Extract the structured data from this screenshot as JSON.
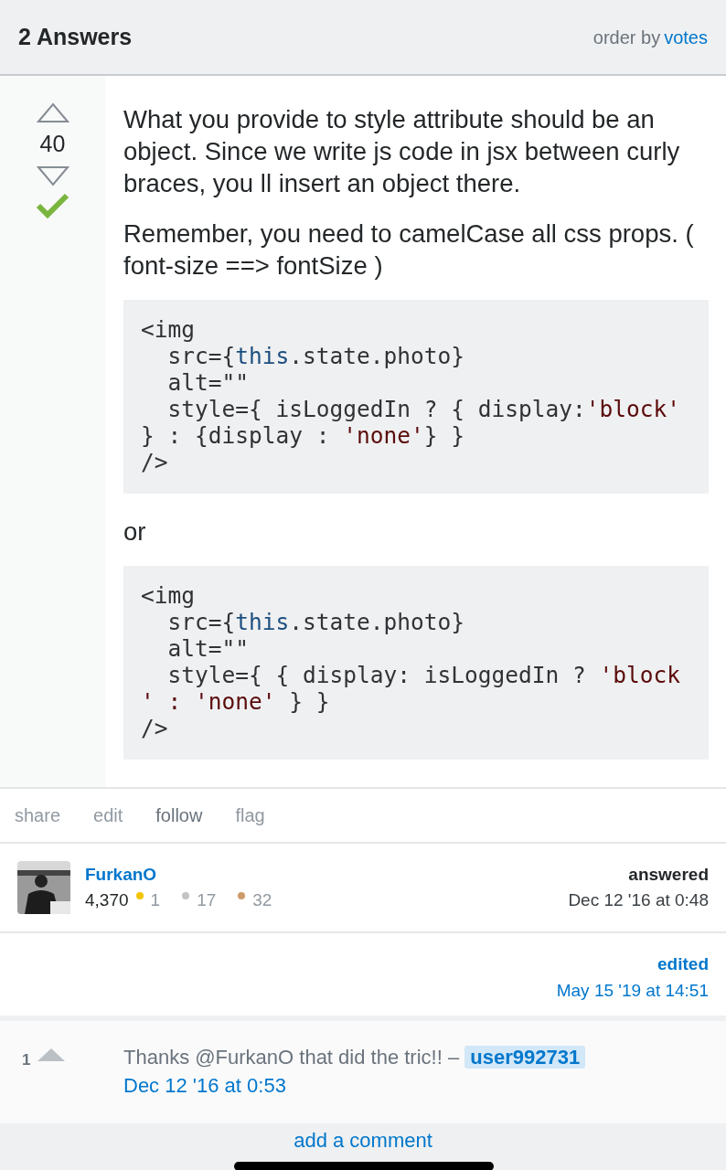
{
  "header": {
    "title": "2 Answers",
    "order_label": "order by",
    "order_value": "votes"
  },
  "answer": {
    "votes": "40",
    "accepted": true,
    "paragraphs": [
      "What you provide to style attribute should be an object. Since we write js code in jsx between curly braces, you ll insert an object there.",
      "Remember, you need to camelCase all css props. ( font-size ==> fontSize )"
    ],
    "code_blocks": [
      {
        "lines": [
          [
            {
              "text": "<img",
              "kind": "plain"
            }
          ],
          [
            {
              "text": "  src={",
              "kind": "plain"
            },
            {
              "text": "this",
              "kind": "keyword"
            },
            {
              "text": ".state.photo}",
              "kind": "plain"
            }
          ],
          [
            {
              "text": "  alt=\"\"",
              "kind": "plain"
            }
          ],
          [
            {
              "text": "  style={ isLoggedIn ? { display:",
              "kind": "plain"
            },
            {
              "text": "'block'",
              "kind": "string"
            }
          ],
          [
            {
              "text": "} : {display : ",
              "kind": "plain"
            },
            {
              "text": "'none'",
              "kind": "string"
            },
            {
              "text": "} }",
              "kind": "plain"
            }
          ],
          [
            {
              "text": "/>",
              "kind": "plain"
            }
          ]
        ]
      },
      {
        "lines": [
          [
            {
              "text": "<img",
              "kind": "plain"
            }
          ],
          [
            {
              "text": "  src={",
              "kind": "plain"
            },
            {
              "text": "this",
              "kind": "keyword"
            },
            {
              "text": ".state.photo}",
              "kind": "plain"
            }
          ],
          [
            {
              "text": "  alt=\"\"",
              "kind": "plain"
            }
          ],
          [
            {
              "text": "  style={ { display: isLoggedIn ? ",
              "kind": "plain"
            },
            {
              "text": "'block",
              "kind": "string"
            }
          ],
          [
            {
              "text": "' : ",
              "kind": "string"
            },
            {
              "text": "'none'",
              "kind": "string"
            },
            {
              "text": " } }",
              "kind": "plain"
            }
          ],
          [
            {
              "text": "/>",
              "kind": "plain"
            }
          ]
        ]
      }
    ],
    "separator": "or",
    "menu": [
      {
        "label": "share",
        "highlighted": false
      },
      {
        "label": "edit",
        "highlighted": false
      },
      {
        "label": "follow",
        "highlighted": true
      },
      {
        "label": "flag",
        "highlighted": false
      }
    ],
    "author": {
      "name": "FurkanO",
      "reputation": "4,370",
      "badges": [
        {
          "count": "1",
          "color": "#f4c400"
        },
        {
          "count": "17",
          "color": "#c2c4c6"
        },
        {
          "count": "32",
          "color": "#cd9b6a"
        }
      ],
      "action": "answered",
      "time": "Dec 12 '16 at 0:48"
    },
    "editor": {
      "action": "edited",
      "time": "May 15 '19 at 14:51"
    }
  },
  "comments": [
    {
      "score": "1",
      "text": "Thanks @FurkanO that did the tric!! –",
      "user": "user992731",
      "time": "Dec 12 '16 at 0:53"
    }
  ],
  "add_comment": "add a comment"
}
